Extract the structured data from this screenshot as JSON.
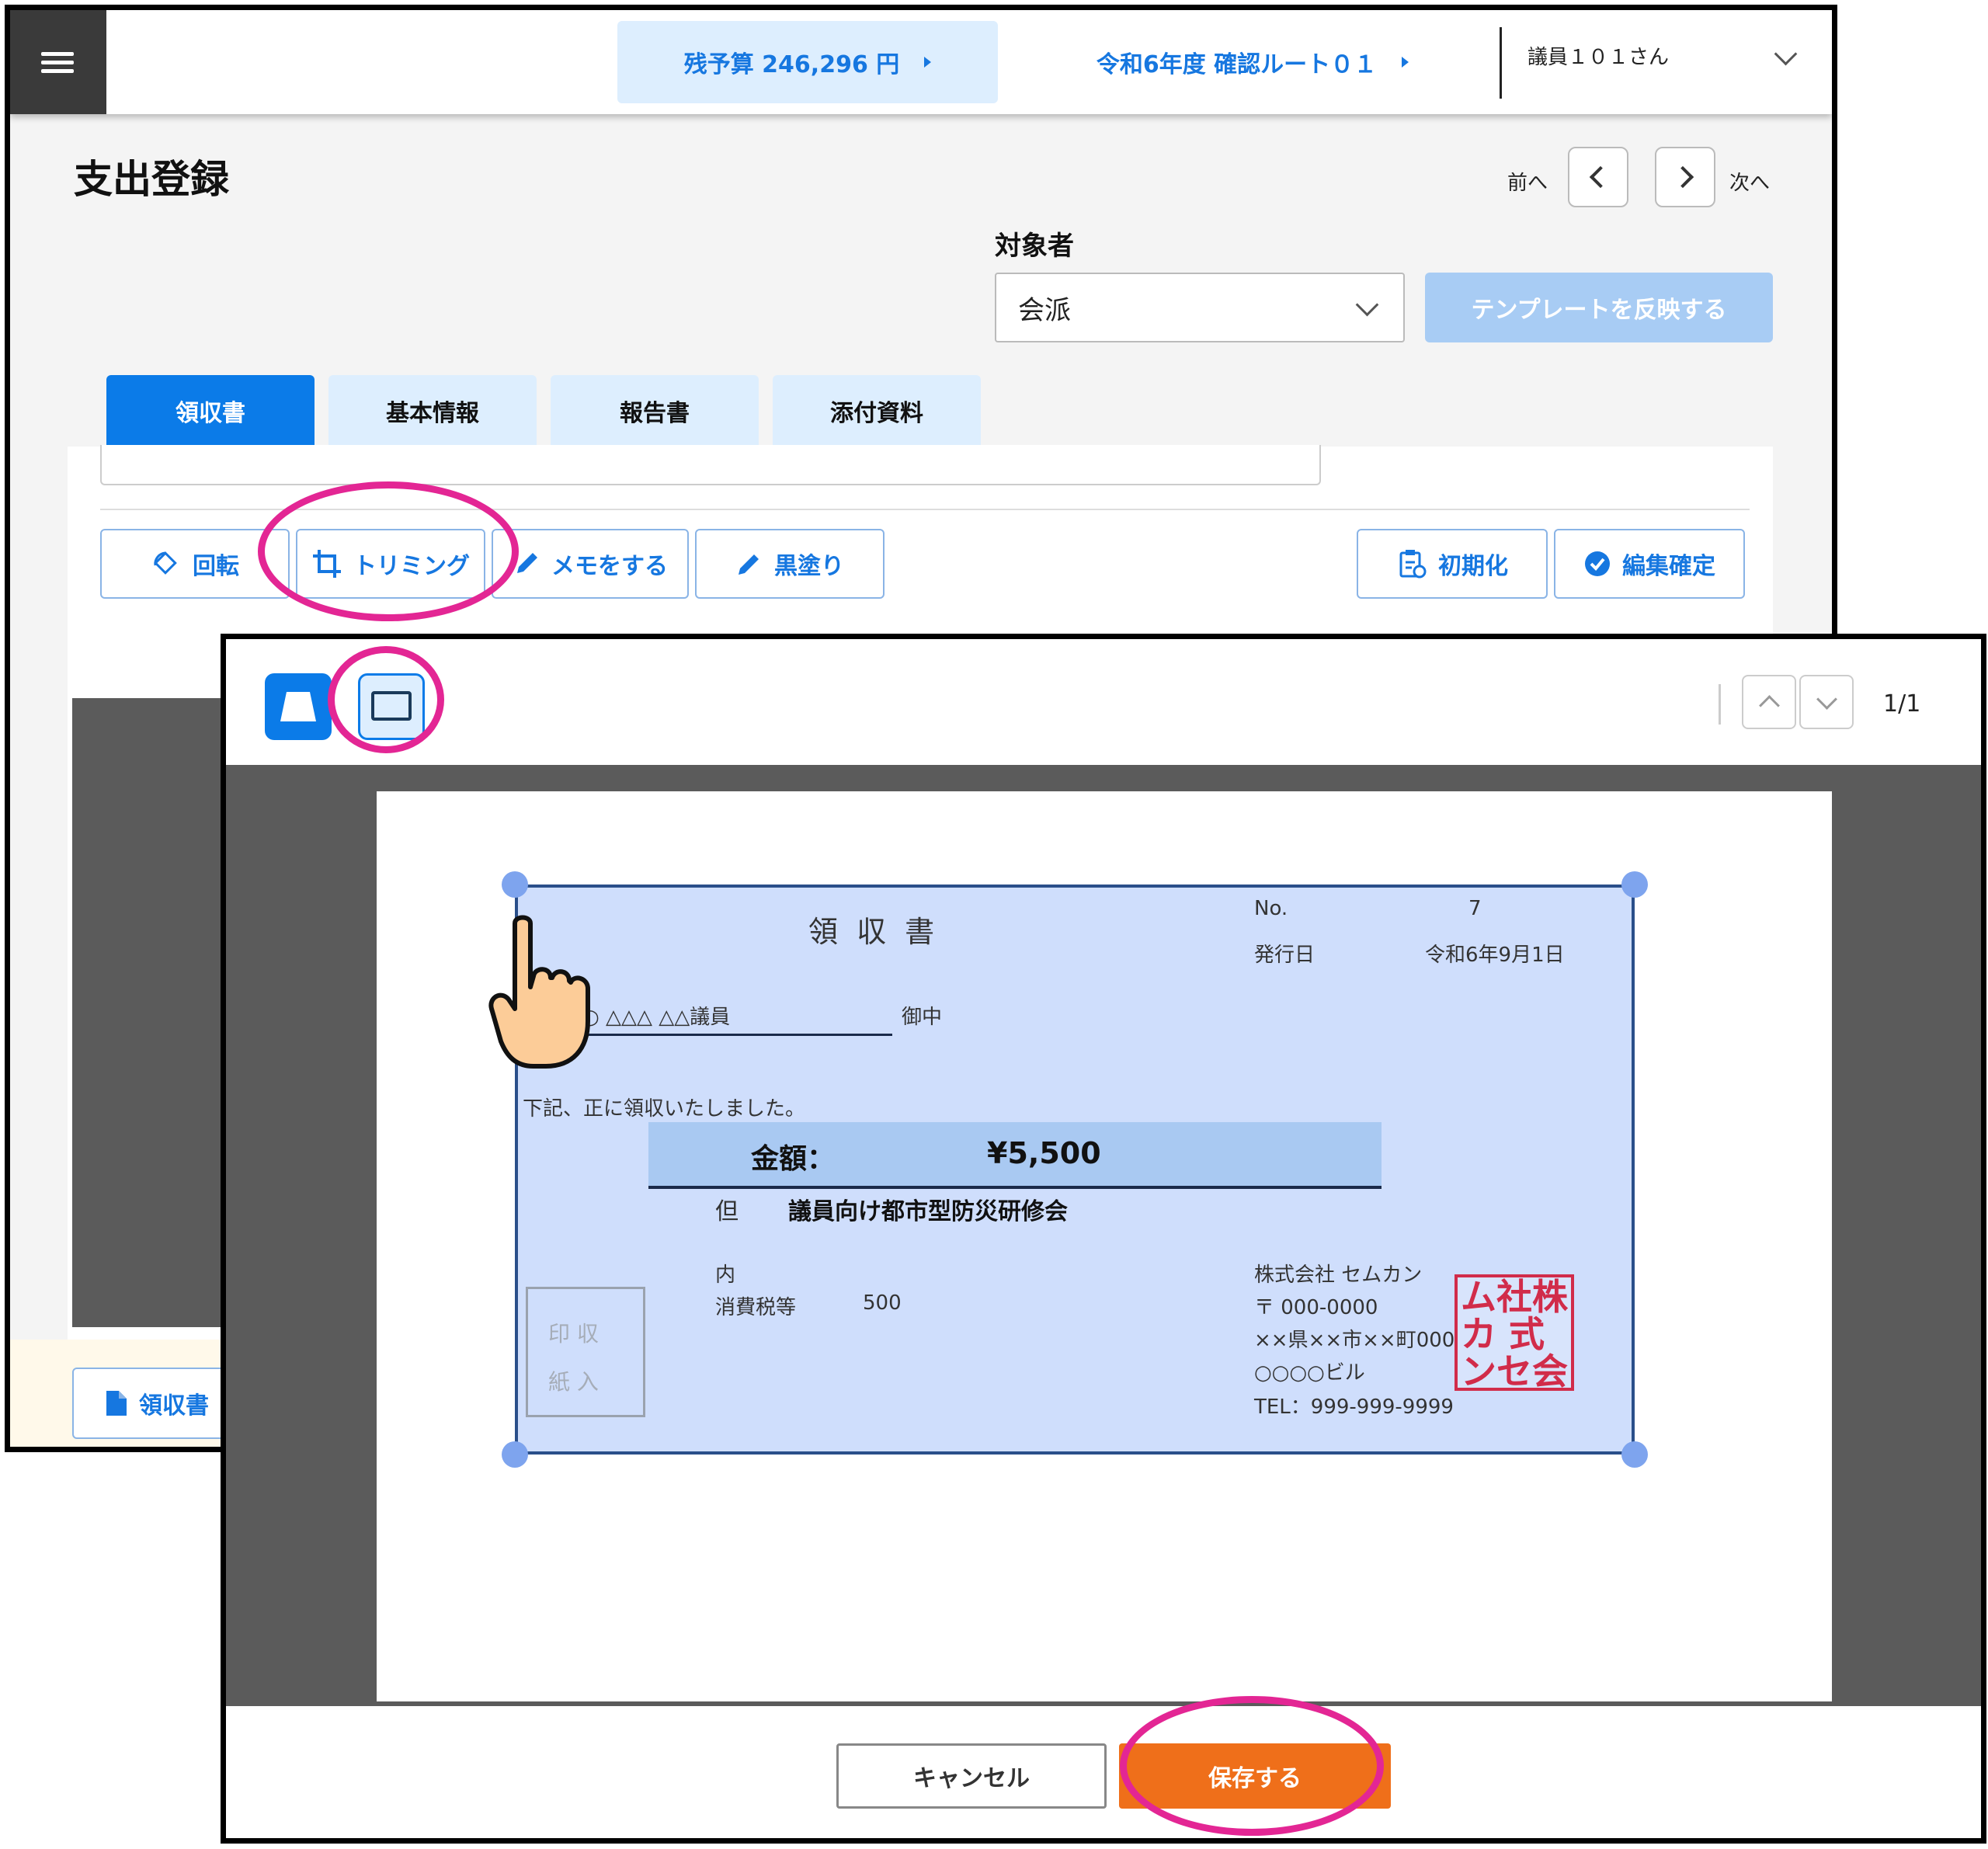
{
  "header": {
    "budget_label": "残予算 246,296 円",
    "route_label": "令和6年度 確認ルート０１",
    "user_label": "議員１０１さん",
    "menu_icon": "hamburger-icon"
  },
  "page": {
    "title": "支出登録",
    "prev_label": "前へ",
    "next_label": "次へ"
  },
  "subject": {
    "label": "対象者",
    "selected": "会派",
    "template_button": "テンプレートを反映する"
  },
  "tabs": [
    {
      "label": "領収書",
      "active": true
    },
    {
      "label": "基本情報"
    },
    {
      "label": "報告書"
    },
    {
      "label": "添付資料"
    }
  ],
  "toolbar": {
    "rotate": "回転",
    "trim": "トリミング",
    "memo": "メモをする",
    "blackout": "黒塗り",
    "reset": "初期化",
    "confirm": "編集確定"
  },
  "footer": {
    "receipt_button": "領収書"
  },
  "modal": {
    "page_indicator": "1/1",
    "cancel": "キャンセル",
    "save": "保存する"
  },
  "receipt": {
    "title": "領 収 書",
    "no_label": "No.",
    "no_value": "7",
    "date_label": "発行日",
    "date_value": "令和6年9月1日",
    "addressee": "○ △△△ △△議員",
    "addressee_suffix": "御中",
    "received_text": "下記、正に領収いたしました。",
    "amount_label": "金額：",
    "amount_value": "¥5,500",
    "purpose_prefix": "但",
    "purpose": "議員向け都市型防災研修会",
    "breakdown_label": "内",
    "tax_label": "消費税等",
    "tax_value": "500",
    "stamp_box_line1": "印 収",
    "stamp_box_line2": "紙 入",
    "company": "株式会社 セムカン",
    "postal": "〒 000-0000",
    "address": "××県××市××町000",
    "building": "○○○○ビル",
    "tel": "TEL：999-999-9999",
    "seal_row1": "ム社株",
    "seal_row2": "カ 式",
    "seal_row3": "ンセ会"
  },
  "colors": {
    "primary": "#0b7be8",
    "accent_text": "#1677e0",
    "tab_inactive": "#ddeefe",
    "save_orange": "#ef6f1a",
    "highlight_ring": "#e32694",
    "crop_fill": "#cfdefc"
  }
}
